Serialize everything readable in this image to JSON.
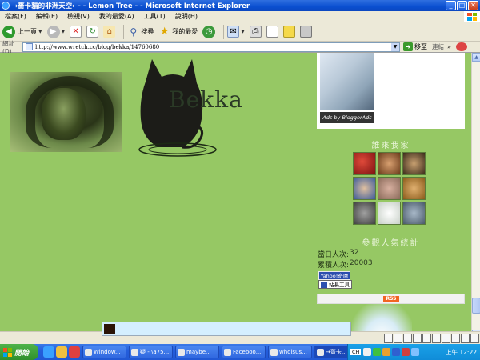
{
  "window": {
    "title": "→薔卡貓的非洲天空←- - Lemon Tree - - Microsoft Internet Explorer",
    "min_label": "_",
    "max_label": "□",
    "close_label": "✕"
  },
  "menu": {
    "items": [
      "檔案(F)",
      "編輯(E)",
      "檢視(V)",
      "我的最愛(A)",
      "工具(T)",
      "說明(H)"
    ]
  },
  "toolbar": {
    "back_label": "上一頁",
    "search_label": "搜尋",
    "favorites_label": "我的最愛"
  },
  "address": {
    "label": "網址(D)",
    "url": "http://www.wretch.cc/blog/bekka/14760680",
    "go_label": "移至",
    "links_label": "連結"
  },
  "page": {
    "logo_text": "Bekka",
    "ad_label": "Ads by BloggerAds",
    "visitors_title": "誰來我家",
    "stats_title": "參觀人氣統計",
    "today_label": "當日人次:",
    "today_value": "32",
    "total_label": "累積人次:",
    "total_value": "20003",
    "yahoo_label": "Yahoo!奇摩",
    "tools_label": "站長工具",
    "rss_label": "RSS",
    "avatar_colors": [
      "#b22222",
      "#a0522d",
      "#6b4a2a",
      "#4a6fa5",
      "#9e7a6a",
      "#b8862f",
      "#6a6a6a",
      "#e8ece8",
      "#6f7f8f"
    ]
  },
  "taskbar": {
    "start_label": "開始",
    "items": [
      "Window...",
      "疑 - \\a75...",
      "maybe...",
      "Faceboo...",
      "whoisus...",
      "→薔卡..."
    ],
    "ime_label": "CH",
    "clock": "上午 12:22"
  }
}
